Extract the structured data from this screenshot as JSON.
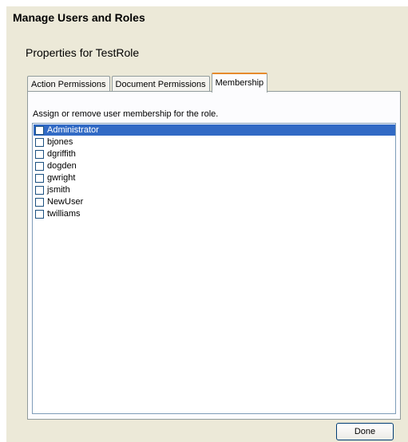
{
  "dialog": {
    "title": "Manage Users and Roles",
    "subtitle": "Properties for TestRole"
  },
  "tabs": [
    {
      "label": "Action Permissions",
      "active": false
    },
    {
      "label": "Document Permissions",
      "active": false
    },
    {
      "label": "Membership",
      "active": true
    }
  ],
  "membership": {
    "instruction": "Assign or remove user membership for the role.",
    "users": [
      {
        "name": "Administrator",
        "checked": false,
        "selected": true
      },
      {
        "name": "bjones",
        "checked": false,
        "selected": false
      },
      {
        "name": "dgriffith",
        "checked": false,
        "selected": false
      },
      {
        "name": "dogden",
        "checked": false,
        "selected": false
      },
      {
        "name": "gwright",
        "checked": false,
        "selected": false
      },
      {
        "name": "jsmith",
        "checked": false,
        "selected": false
      },
      {
        "name": "NewUser",
        "checked": false,
        "selected": false
      },
      {
        "name": "twilliams",
        "checked": false,
        "selected": false
      }
    ]
  },
  "buttons": {
    "done_label": "Done"
  },
  "colors": {
    "dialog_bg": "#ece9d8",
    "selection": "#316ac5",
    "active_tab_accent": "#e68b2c"
  }
}
